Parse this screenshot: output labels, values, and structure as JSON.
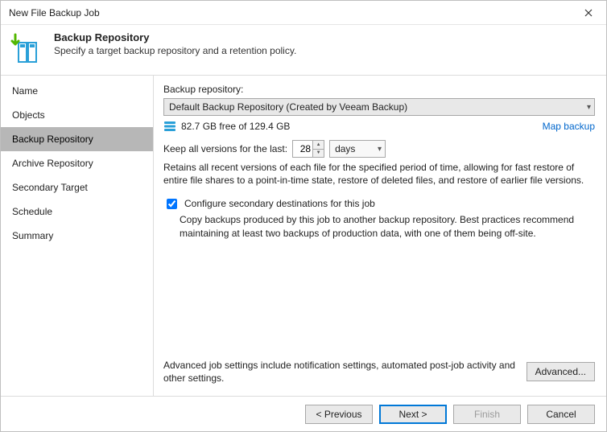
{
  "window": {
    "title": "New File Backup Job"
  },
  "header": {
    "title": "Backup Repository",
    "subtitle": "Specify a target backup repository and a retention policy."
  },
  "sidebar": {
    "items": [
      {
        "label": "Name"
      },
      {
        "label": "Objects"
      },
      {
        "label": "Backup Repository"
      },
      {
        "label": "Archive Repository"
      },
      {
        "label": "Secondary Target"
      },
      {
        "label": "Schedule"
      },
      {
        "label": "Summary"
      }
    ],
    "active_index": 2
  },
  "content": {
    "repo_label": "Backup repository:",
    "repo_selected": "Default Backup Repository (Created by Veeam Backup)",
    "free_space": "82.7 GB free of 129.4 GB",
    "map_link": "Map backup",
    "keep_label": "Keep all versions for the last:",
    "keep_value": "28",
    "keep_unit": "days",
    "retain_desc": "Retains all recent versions of each file for the specified period of time, allowing for fast restore of entire file shares to a point-in-time state, restore of deleted files, and restore of earlier file versions.",
    "secondary_check_label": "Configure secondary destinations for this job",
    "secondary_check_checked": true,
    "secondary_desc": "Copy backups produced by this job to another backup repository. Best practices recommend maintaining at least two backups of production data, with one of them being off-site.",
    "advanced_text": "Advanced job settings include notification settings, automated post-job activity and other settings.",
    "advanced_button": "Advanced..."
  },
  "footer": {
    "previous": "< Previous",
    "next": "Next >",
    "finish": "Finish",
    "cancel": "Cancel"
  }
}
